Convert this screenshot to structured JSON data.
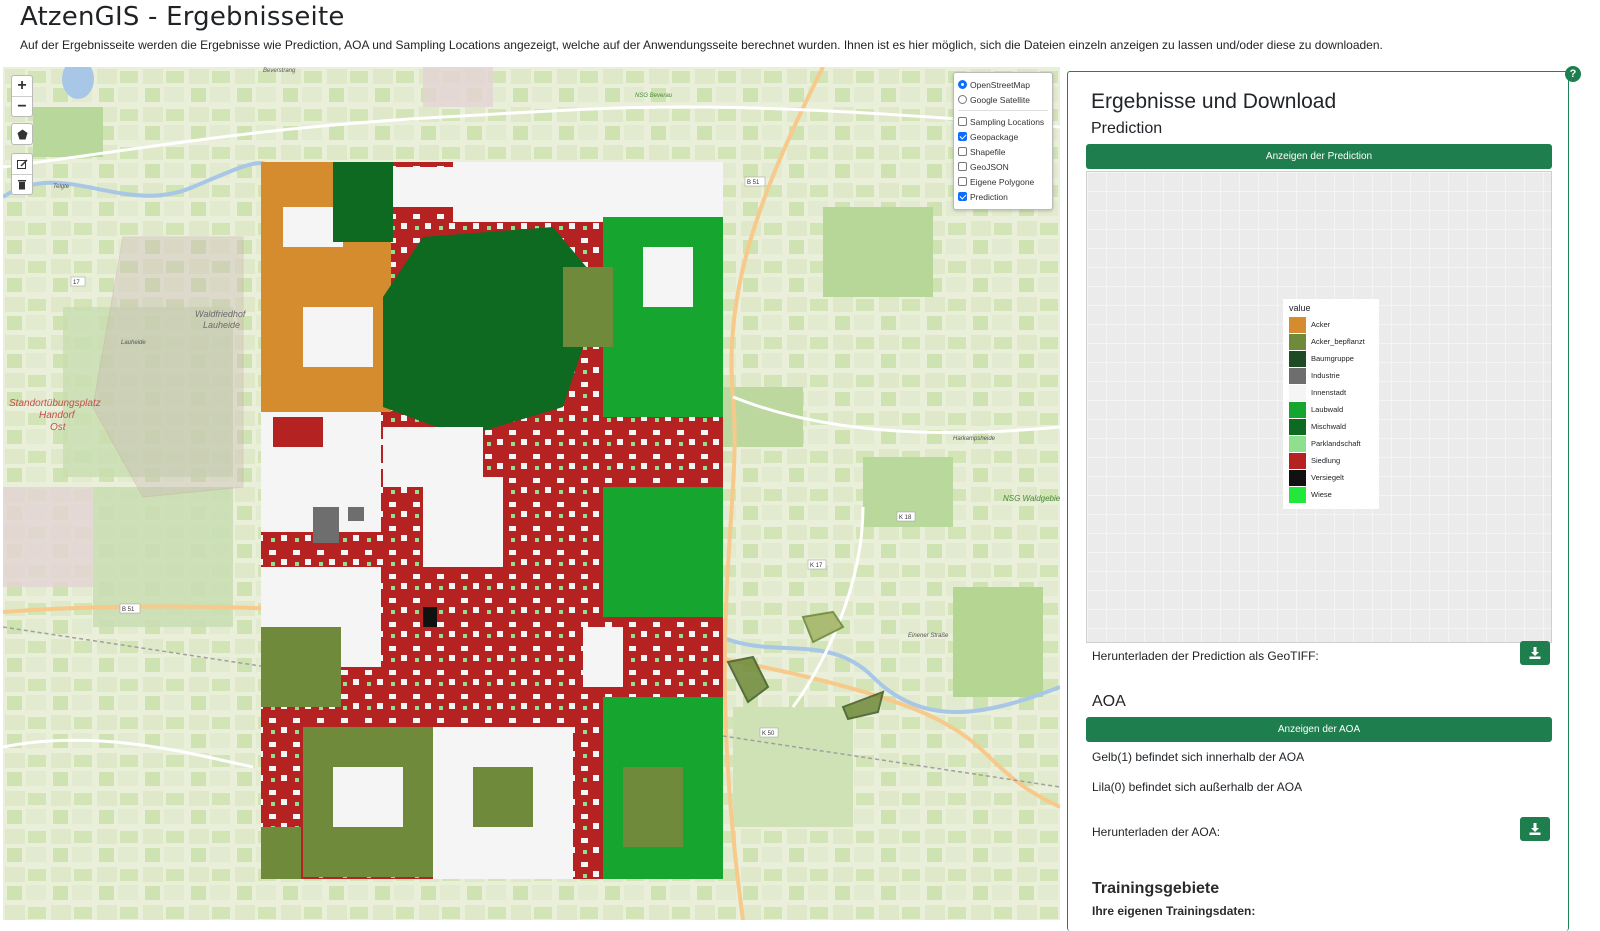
{
  "page": {
    "title": "AtzenGIS - Ergebnisseite",
    "subtitle": "Auf der Ergebnisseite werden die Ergebnisse wie Prediction, AOA und Sampling Locations angezeigt, welche auf der Anwendungsseite berechnet wurden. Ihnen ist es hier möglich, sich die Dateien einzeln anzeigen zu lassen und/oder diese zu downloaden."
  },
  "map": {
    "zoom_in": "+",
    "zoom_out": "−",
    "labels": {
      "place1": "Waldfriedhof",
      "place2": "Lauheide",
      "place3": "Standortübungsplatz",
      "place4": "Handorf",
      "place5": "Ost",
      "road1": "B 51",
      "road2": "B 51",
      "road3": "K 18",
      "road4": "K 17",
      "road5": "K 50",
      "nsg": "NSG Waldgebiet Harkampsheide",
      "nsg_top": "NSG Beverau",
      "street1": "Harkampsheide",
      "street2": "Einener Straße",
      "street3": "Lauheide",
      "street4": "Beverstrang",
      "street5": "Telgte",
      "road6": "17",
      "bev": "Beverau"
    },
    "layers": {
      "base": [
        {
          "label": "OpenStreetMap",
          "selected": true
        },
        {
          "label": "Google Satellite",
          "selected": false
        }
      ],
      "overlays": [
        {
          "label": "Sampling Locations",
          "checked": false
        },
        {
          "label": "Geopackage",
          "checked": true
        },
        {
          "label": "Shapefile",
          "checked": false
        },
        {
          "label": "GeoJSON",
          "checked": false
        },
        {
          "label": "Eigene Polygone",
          "checked": false
        },
        {
          "label": "Prediction",
          "checked": true
        }
      ]
    }
  },
  "panel": {
    "title": "Ergebnisse und Download",
    "prediction": {
      "heading": "Prediction",
      "show_button": "Anzeigen der Prediction",
      "download_label": "Herunterladen der Prediction als GeoTIFF:",
      "legend_title": "value",
      "legend": [
        {
          "label": "Acker",
          "color": "#d48c2f"
        },
        {
          "label": "Acker_bepflanzt",
          "color": "#6f8a3a"
        },
        {
          "label": "Baumgruppe",
          "color": "#1f4a26"
        },
        {
          "label": "Industrie",
          "color": "#6e6e6e"
        },
        {
          "label": "Innenstadt",
          "color": "#f5f5f5"
        },
        {
          "label": "Laubwald",
          "color": "#16a52e"
        },
        {
          "label": "Mischwald",
          "color": "#0e6a21"
        },
        {
          "label": "Parklandschaft",
          "color": "#8fe08e"
        },
        {
          "label": "Siedlung",
          "color": "#b52222"
        },
        {
          "label": "Versiegelt",
          "color": "#111111"
        },
        {
          "label": "Wiese",
          "color": "#22e83a"
        }
      ]
    },
    "aoa": {
      "heading": "AOA",
      "show_button": "Anzeigen der AOA",
      "line1": "Gelb(1) befindet sich innerhalb der AOA",
      "line2": "Lila(0) befindet sich außerhalb der AOA",
      "download_label": "Herunterladen der AOA:"
    },
    "training": {
      "heading": "Trainingsgebiete",
      "sub": "Ihre eigenen Trainingsdaten:"
    }
  },
  "colors": {
    "accent": "#1e7e4e",
    "map_bg": "#e6ecd8"
  }
}
